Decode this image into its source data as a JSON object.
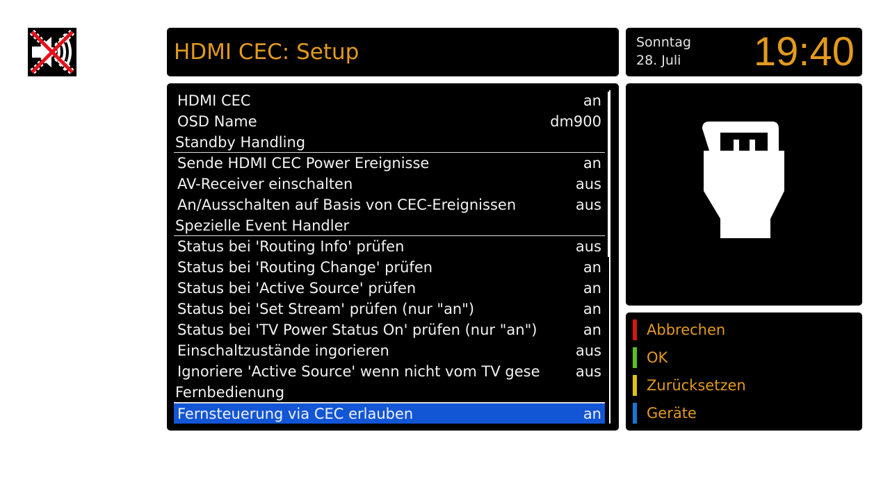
{
  "status": {
    "mute_icon": "mute-icon"
  },
  "header": {
    "title": "HDMI CEC: Setup"
  },
  "clock": {
    "day": "Sonntag",
    "date": "28. Juli",
    "time": "19:40"
  },
  "menu": {
    "items": [
      {
        "label": "HDMI CEC",
        "value": "an",
        "type": "option"
      },
      {
        "label": "OSD Name",
        "value": "dm900",
        "type": "option"
      },
      {
        "label": "Standby Handling",
        "value": "",
        "type": "section"
      },
      {
        "label": "Sende HDMI CEC Power Ereignisse",
        "value": "an",
        "type": "option"
      },
      {
        "label": "AV-Receiver einschalten",
        "value": "aus",
        "type": "option"
      },
      {
        "label": "An/Ausschalten auf Basis von CEC-Ereignissen",
        "value": "aus",
        "type": "option"
      },
      {
        "label": "Spezielle Event Handler",
        "value": "",
        "type": "section"
      },
      {
        "label": "Status bei 'Routing Info' prüfen",
        "value": "aus",
        "type": "option"
      },
      {
        "label": "Status bei 'Routing Change' prüfen",
        "value": "an",
        "type": "option"
      },
      {
        "label": "Status bei 'Active Source' prüfen",
        "value": "an",
        "type": "option"
      },
      {
        "label": "Status bei 'Set Stream' prüfen (nur \"an\")",
        "value": "an",
        "type": "option"
      },
      {
        "label": "Status bei 'TV Power Status On' prüfen (nur \"an\")",
        "value": "an",
        "type": "option"
      },
      {
        "label": "Einschaltzustände ingorieren",
        "value": "aus",
        "type": "option"
      },
      {
        "label": "Ignoriere 'Active Source' wenn nicht vom TV gese",
        "value": "aus",
        "type": "option"
      },
      {
        "label": "Fernbedienung",
        "value": "",
        "type": "section"
      },
      {
        "label": "Fernsteuerung via CEC erlauben",
        "value": "an",
        "type": "option",
        "selected": true
      }
    ]
  },
  "preview": {
    "icon": "hdmi-plug-icon"
  },
  "keys": [
    {
      "label": "Abbrechen",
      "color": "#d01a10",
      "name": "red-key-cancel"
    },
    {
      "label": "OK",
      "color": "#5ac21d",
      "name": "green-key-ok"
    },
    {
      "label": "Zurücksetzen",
      "color": "#e0c20e",
      "name": "yellow-key-reset"
    },
    {
      "label": "Geräte",
      "color": "#1577d8",
      "name": "blue-key-devices"
    }
  ],
  "colors": {
    "accent": "#e39a1e",
    "selection": "#1256d6",
    "panel": "#000000"
  }
}
